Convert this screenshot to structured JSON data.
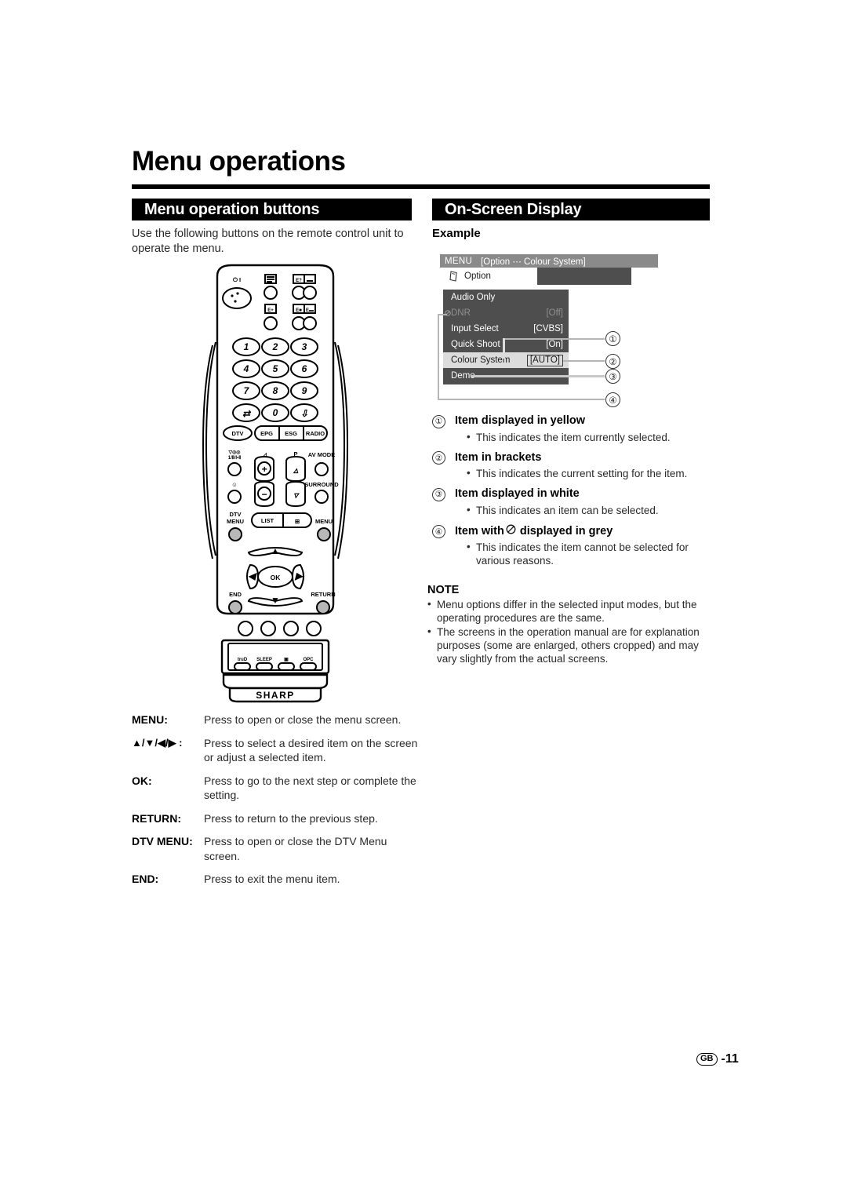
{
  "page": {
    "title": "Menu operations",
    "footer_region": "GB",
    "footer_page": "-11"
  },
  "left_section": {
    "header": "Menu operation buttons",
    "intro": "Use the following buttons on the remote control unit to operate the menu.",
    "button_table": [
      {
        "key": "MENU:",
        "desc": "Press to open or close the menu screen."
      },
      {
        "key": "▲/▼/◀/▶ :",
        "desc": "Press to select a desired item on the screen or adjust a selected item."
      },
      {
        "key": "OK:",
        "desc": "Press to go to the next step or complete the setting."
      },
      {
        "key": "RETURN:",
        "desc": "Press to return to the previous step."
      },
      {
        "key": "DTV MENU:",
        "desc": "Press to open or close the DTV Menu screen."
      },
      {
        "key": "END:",
        "desc": "Press to exit the menu item."
      }
    ]
  },
  "remote": {
    "brand": "SHARP",
    "power_label": "⏻ I",
    "number_keys": [
      "1",
      "2",
      "3",
      "4",
      "5",
      "6",
      "7",
      "8",
      "9",
      "0"
    ],
    "source_keys": [
      "DTV",
      "EPG",
      "ESG",
      "RADIO"
    ],
    "audio_label": "1/Ⅱ/Ⅰ•Ⅱ",
    "volume_label": "◳",
    "volume_plus": "+",
    "volume_minus": "−",
    "programme_label": "P",
    "av_mode_label": "AV MODE",
    "surround_label": "SURROUND",
    "dtv_menu_label": "DTV MENU",
    "list_label": "LIST",
    "menu_label": "MENU",
    "ok_label": "OK",
    "end_label": "END",
    "return_label": "RETURN",
    "bottom_keys": [
      "truD",
      "SLEEP",
      "▣",
      "OPC"
    ]
  },
  "right_section": {
    "header": "On-Screen Display",
    "example_label": "Example",
    "osd": {
      "menu_word": "MENU",
      "breadcrumb": "[Option ⋯ Colour System]",
      "tab_label": "Option",
      "rows": [
        {
          "label": "Audio Only",
          "value": "",
          "state": "normal"
        },
        {
          "label": "DNR",
          "value": "[Off]",
          "state": "disabled"
        },
        {
          "label": "Input Select",
          "value": "[CVBS]",
          "state": "normal"
        },
        {
          "label": "Quick Shoot",
          "value": "[On]",
          "state": "normal"
        },
        {
          "label": "Colour System",
          "value": "[AUTO]",
          "state": "selected"
        },
        {
          "label": "Demo",
          "value": "",
          "state": "normal"
        }
      ]
    },
    "callouts": [
      "①",
      "②",
      "③",
      "④"
    ],
    "legend": [
      {
        "num": "①",
        "title": "Item displayed in yellow",
        "desc": "This indicates the item currently selected."
      },
      {
        "num": "②",
        "title": "Item in brackets",
        "desc": "This indicates the current setting for the item."
      },
      {
        "num": "③",
        "title": "Item displayed in white",
        "desc": "This indicates an item can be selected."
      },
      {
        "num": "④",
        "title_before": "Item with",
        "title_after": "displayed in grey",
        "desc": "This indicates the item cannot be selected for various reasons."
      }
    ],
    "note": {
      "title": "NOTE",
      "items": [
        "Menu options differ in the selected input modes, but the operating procedures are the same.",
        "The screens in the operation manual are for explanation purposes (some are enlarged, others cropped) and may vary slightly from the actual screens."
      ]
    }
  }
}
